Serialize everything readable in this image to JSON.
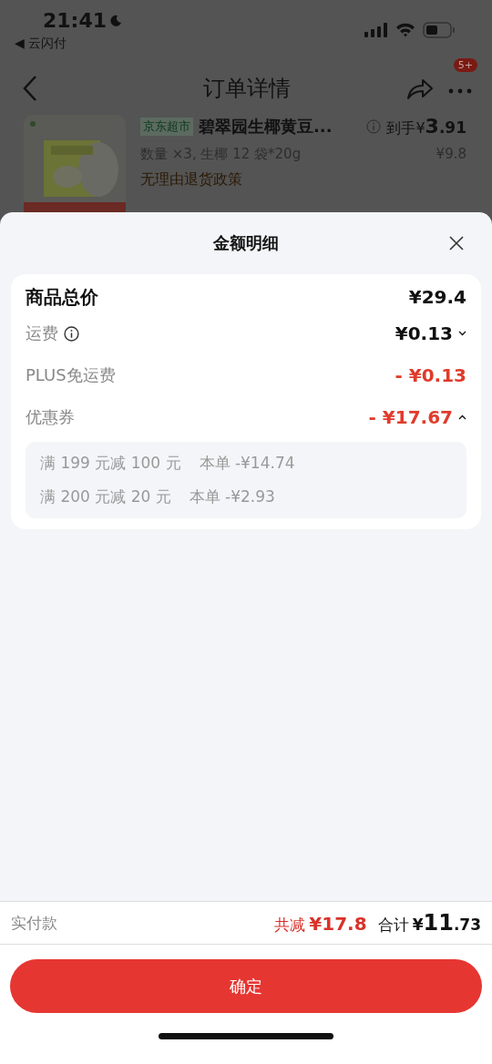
{
  "status_bar": {
    "time": "21:41",
    "back_app": "◀ 云闪付"
  },
  "nav": {
    "title": "订单详情",
    "badge": "5+"
  },
  "product": {
    "tag": "京东超市",
    "title": "碧翠园生椰黄豆...",
    "price_label": "到手¥",
    "price_int": "3",
    "price_dec": ".91",
    "spec": "数量 ×3, 生椰 12 袋*20g",
    "original_price": "¥9.8",
    "policy": "无理由退货政策"
  },
  "sheet": {
    "title": "金额明细",
    "rows": [
      {
        "kind": "total",
        "label": "商品总价",
        "value": "¥29.4"
      },
      {
        "kind": "fee",
        "label": "运费",
        "value": "¥0.13",
        "info": true,
        "expanded": false
      },
      {
        "kind": "discount",
        "label": "PLUS免运费",
        "value": "- ¥0.13"
      },
      {
        "kind": "discount",
        "label": "优惠券",
        "value": "- ¥17.67",
        "expanded": true,
        "details": [
          {
            "rule": "满 199 元减 100 元",
            "amount": "本单 -¥14.74"
          },
          {
            "rule": "满 200 元减 20 元",
            "amount": "本单 -¥2.93"
          }
        ]
      }
    ]
  },
  "footer": {
    "label": "实付款",
    "saved_label": "共减",
    "saved_value": "¥17.8",
    "total_label": "合计",
    "total_currency": "¥",
    "total_int": "11",
    "total_dec": ".73"
  },
  "confirm_button": "确定"
}
